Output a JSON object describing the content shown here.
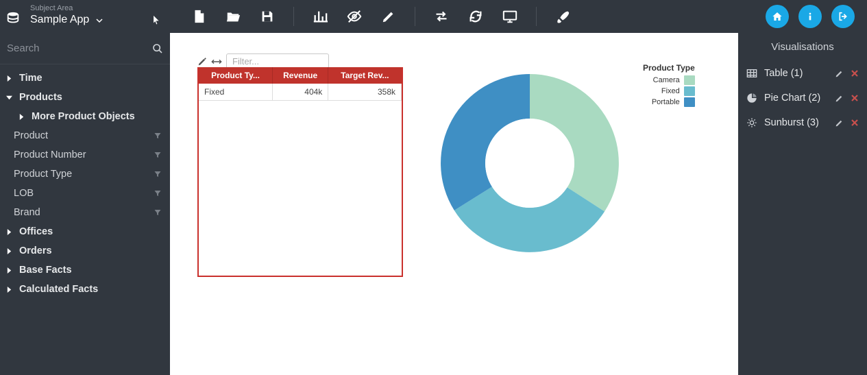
{
  "subject_area": {
    "label": "Subject Area",
    "selected": "Sample App"
  },
  "search": {
    "placeholder": "Search"
  },
  "tree": {
    "time": "Time",
    "products": "Products",
    "more_product_objects": "More Product Objects",
    "leaves": [
      {
        "name": "Product"
      },
      {
        "name": "Product Number"
      },
      {
        "name": "Product Type"
      },
      {
        "name": "LOB"
      },
      {
        "name": "Brand"
      }
    ],
    "offices": "Offices",
    "orders": "Orders",
    "base_facts": "Base Facts",
    "calculated_facts": "Calculated Facts"
  },
  "filter": {
    "placeholder": "Filter..."
  },
  "table": {
    "headers": [
      "Product Ty...",
      "Revenue",
      "Target Rev..."
    ],
    "rows": [
      {
        "c0": "Fixed",
        "c1": "404k",
        "c2": "358k"
      }
    ]
  },
  "legend": {
    "title": "Product Type",
    "items": [
      {
        "label": "Camera",
        "color": "#a9dac1"
      },
      {
        "label": "Fixed",
        "color": "#69bcce"
      },
      {
        "label": "Portable",
        "color": "#3f8fc4"
      }
    ]
  },
  "chart_data": {
    "type": "pie",
    "title": "Product Type",
    "series": [
      {
        "name": "Camera",
        "value": 36,
        "color": "#a9dac1"
      },
      {
        "name": "Fixed",
        "value": 30,
        "color": "#69bcce"
      },
      {
        "name": "Portable",
        "value": 34,
        "color": "#3f8fc4"
      }
    ],
    "donut": true
  },
  "right_panel": {
    "title": "Visualisations",
    "items": [
      {
        "label": "Table (1)",
        "icon": "table"
      },
      {
        "label": "Pie Chart (2)",
        "icon": "pie"
      },
      {
        "label": "Sunburst (3)",
        "icon": "sunburst"
      }
    ]
  }
}
